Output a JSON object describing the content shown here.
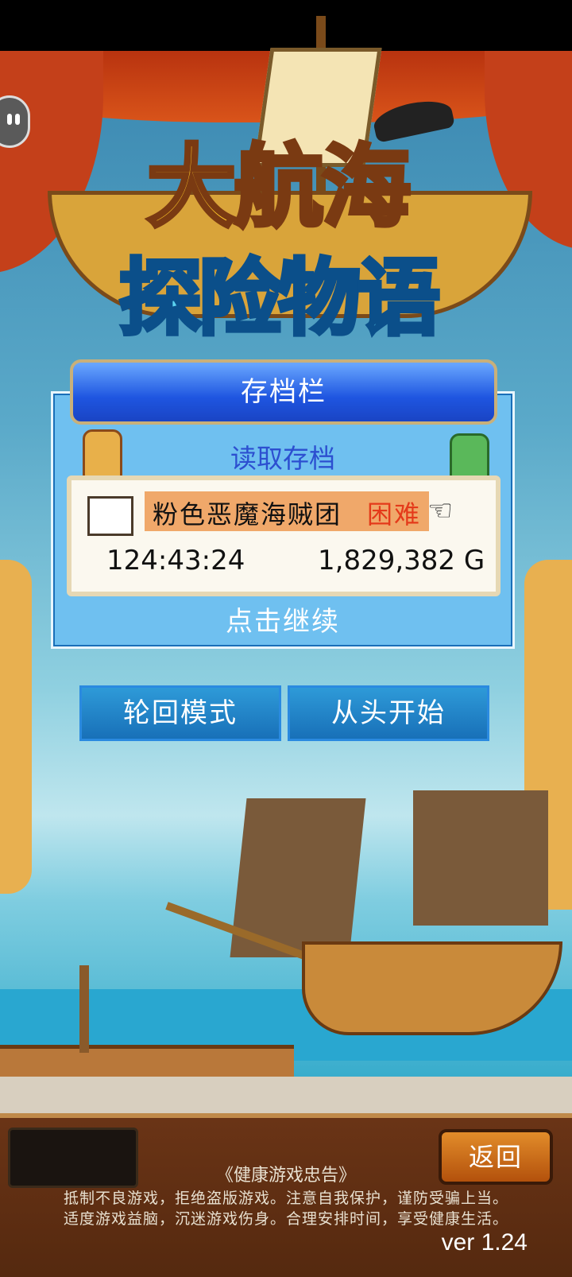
{
  "logo": {
    "line1": "大航海",
    "line2": "探险物语"
  },
  "save_panel": {
    "header": "存档栏",
    "load_label": "读取存档",
    "slot": {
      "name": "粉色恶魔海贼团",
      "difficulty": "困难",
      "play_time": "124:43:24",
      "gold": "1,829,382 G"
    },
    "continue_label": "点击继续"
  },
  "modes": {
    "reincarnation": "轮回模式",
    "new_game": "从头开始"
  },
  "footer": {
    "back_label": "返回",
    "notice_title": "《健康游戏忠告》",
    "notice_line1": "抵制不良游戏，拒绝盗版游戏。注意自我保护，谨防受骗上当。",
    "notice_line2": "适度游戏益脑，沉迷游戏伤身。合理安排时间，享受健康生活。",
    "version": "ver 1.24"
  },
  "colors": {
    "accent_blue": "#1e55e0",
    "panel": "#6fc0f0",
    "difficulty": "#e43a1a",
    "back_button": "#e28c2a"
  },
  "icons": [
    "pause-icon",
    "quill-book-icon",
    "pointing-hand-icon"
  ]
}
